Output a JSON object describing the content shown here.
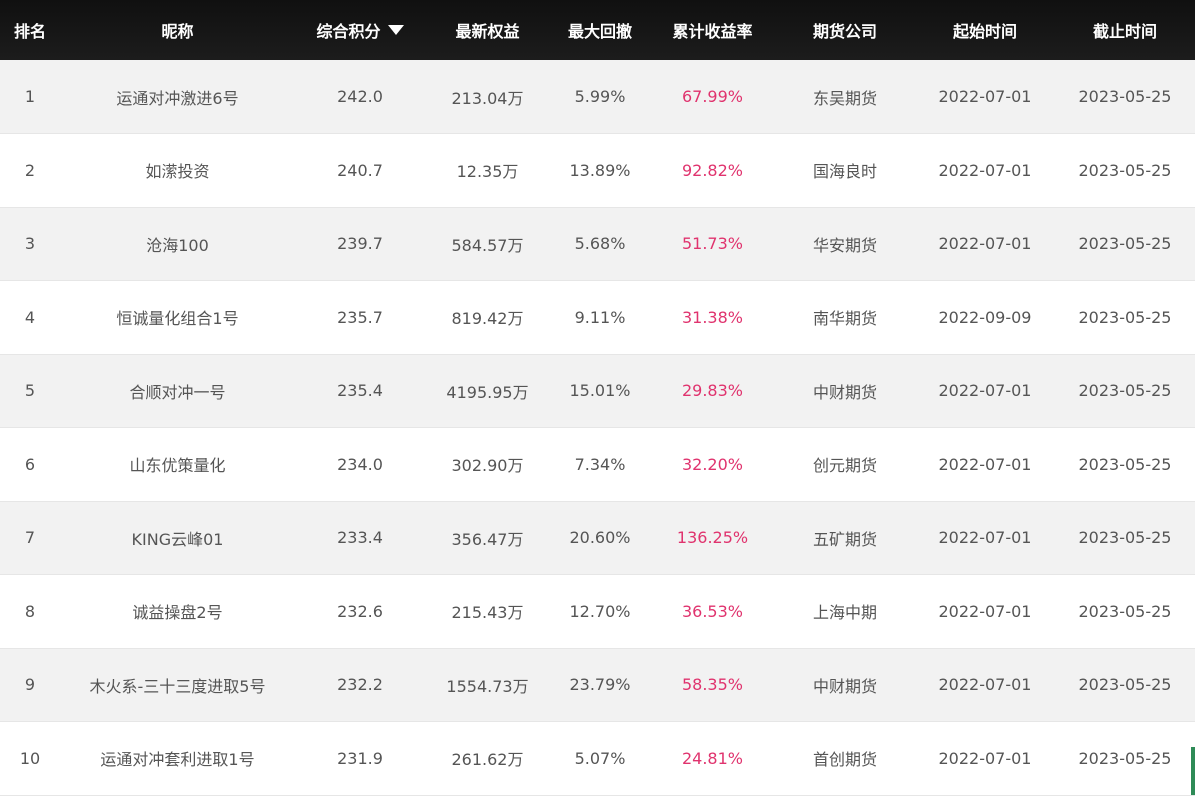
{
  "table": {
    "headers": {
      "rank": "排名",
      "nickname": "昵称",
      "score": "综合积分",
      "equity": "最新权益",
      "drawdown": "最大回撤",
      "return": "累计收益率",
      "company": "期货公司",
      "start": "起始时间",
      "end": "截止时间"
    },
    "sort_icon": "sort-descending-triangle-icon",
    "accent_color": "#e0336e",
    "rows": [
      {
        "rank": "1",
        "nickname": "运通对冲激进6号",
        "score": "242.0",
        "equity": "213.04万",
        "drawdown": "5.99%",
        "return": "67.99%",
        "company": "东吴期货",
        "start": "2022-07-01",
        "end": "2023-05-25"
      },
      {
        "rank": "2",
        "nickname": "如潆投资",
        "score": "240.7",
        "equity": "12.35万",
        "drawdown": "13.89%",
        "return": "92.82%",
        "company": "国海良时",
        "start": "2022-07-01",
        "end": "2023-05-25"
      },
      {
        "rank": "3",
        "nickname": "沧海100",
        "score": "239.7",
        "equity": "584.57万",
        "drawdown": "5.68%",
        "return": "51.73%",
        "company": "华安期货",
        "start": "2022-07-01",
        "end": "2023-05-25"
      },
      {
        "rank": "4",
        "nickname": "恒诚量化组合1号",
        "score": "235.7",
        "equity": "819.42万",
        "drawdown": "9.11%",
        "return": "31.38%",
        "company": "南华期货",
        "start": "2022-09-09",
        "end": "2023-05-25"
      },
      {
        "rank": "5",
        "nickname": "合顺对冲一号",
        "score": "235.4",
        "equity": "4195.95万",
        "drawdown": "15.01%",
        "return": "29.83%",
        "company": "中财期货",
        "start": "2022-07-01",
        "end": "2023-05-25"
      },
      {
        "rank": "6",
        "nickname": "山东优策量化",
        "score": "234.0",
        "equity": "302.90万",
        "drawdown": "7.34%",
        "return": "32.20%",
        "company": "创元期货",
        "start": "2022-07-01",
        "end": "2023-05-25"
      },
      {
        "rank": "7",
        "nickname": "KING云峰01",
        "score": "233.4",
        "equity": "356.47万",
        "drawdown": "20.60%",
        "return": "136.25%",
        "company": "五矿期货",
        "start": "2022-07-01",
        "end": "2023-05-25"
      },
      {
        "rank": "8",
        "nickname": "诚益操盘2号",
        "score": "232.6",
        "equity": "215.43万",
        "drawdown": "12.70%",
        "return": "36.53%",
        "company": "上海中期",
        "start": "2022-07-01",
        "end": "2023-05-25"
      },
      {
        "rank": "9",
        "nickname": "木火系-三十三度进取5号",
        "score": "232.2",
        "equity": "1554.73万",
        "drawdown": "23.79%",
        "return": "58.35%",
        "company": "中财期货",
        "start": "2022-07-01",
        "end": "2023-05-25"
      },
      {
        "rank": "10",
        "nickname": "运通对冲套利进取1号",
        "score": "231.9",
        "equity": "261.62万",
        "drawdown": "5.07%",
        "return": "24.81%",
        "company": "首创期货",
        "start": "2022-07-01",
        "end": "2023-05-25"
      }
    ]
  }
}
